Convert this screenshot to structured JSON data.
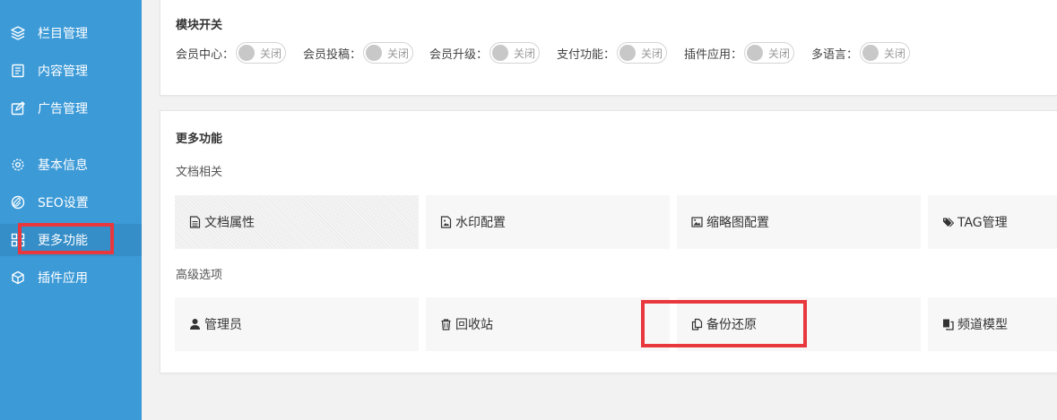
{
  "sidebar": {
    "items": [
      {
        "label": "栏目管理",
        "icon": "layers-icon"
      },
      {
        "label": "内容管理",
        "icon": "document-icon"
      },
      {
        "label": "广告管理",
        "icon": "edit-icon"
      },
      {
        "label": "基本信息",
        "icon": "gear-icon"
      },
      {
        "label": "SEO设置",
        "icon": "paperclip-icon"
      },
      {
        "label": "更多功能",
        "icon": "grid-icon"
      },
      {
        "label": "插件应用",
        "icon": "cube-icon"
      }
    ]
  },
  "modules": {
    "title": "模块开关",
    "switches": [
      {
        "label": "会员中心：",
        "state": "关闭"
      },
      {
        "label": "会员投稿：",
        "state": "关闭"
      },
      {
        "label": "会员升级：",
        "state": "关闭"
      },
      {
        "label": "支付功能：",
        "state": "关闭"
      },
      {
        "label": "插件应用：",
        "state": "关闭"
      },
      {
        "label": "多语言：",
        "state": "关闭"
      }
    ]
  },
  "more": {
    "title": "更多功能",
    "doc_section": "文档相关",
    "doc_items": [
      {
        "label": "文档属性",
        "icon": "file-text-icon"
      },
      {
        "label": "水印配置",
        "icon": "file-image-icon"
      },
      {
        "label": "缩略图配置",
        "icon": "image-icon"
      },
      {
        "label": "TAG管理",
        "icon": "tags-icon"
      }
    ],
    "adv_section": "高级选项",
    "adv_items": [
      {
        "label": "管理员",
        "icon": "user-icon"
      },
      {
        "label": "回收站",
        "icon": "trash-icon"
      },
      {
        "label": "备份还原",
        "icon": "copy-icon"
      },
      {
        "label": "频道模型",
        "icon": "files-icon"
      }
    ]
  }
}
